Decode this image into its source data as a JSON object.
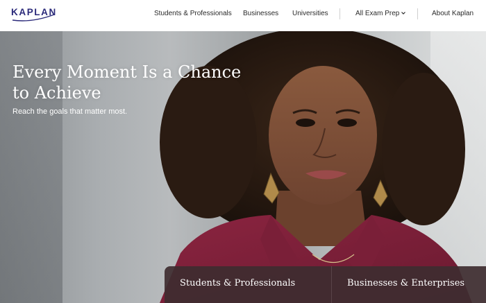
{
  "brand": {
    "logo_text": "KAPLAN"
  },
  "nav": {
    "items": [
      {
        "label": "Students & Professionals"
      },
      {
        "label": "Businesses"
      },
      {
        "label": "Universities"
      },
      {
        "label": "All Exam Prep"
      },
      {
        "label": "About Kaplan"
      }
    ]
  },
  "hero": {
    "title": "Every Moment Is a Chance to Achieve",
    "subtitle": "Reach the goals that matter most."
  },
  "panel": {
    "tabs": [
      {
        "label": "Students & Professionals"
      },
      {
        "label": "Businesses & Enterprises"
      }
    ]
  },
  "colors": {
    "brand": "#2b2a7a",
    "panel_bg": "#3e2c30",
    "shirt": "#7a1e36"
  },
  "icons": [
    "kaplan-logo",
    "chevron-down-icon"
  ]
}
